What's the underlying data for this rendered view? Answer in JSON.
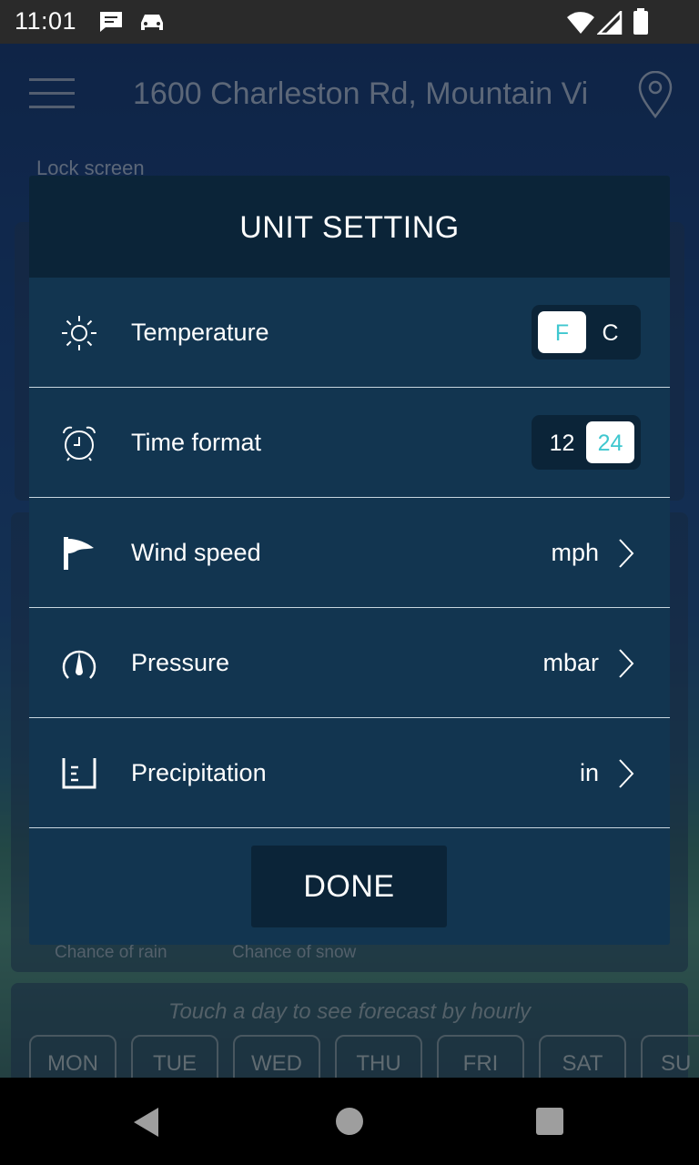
{
  "status_bar": {
    "time": "11:01",
    "left_icons": [
      "message-icon",
      "car-icon"
    ],
    "right_icons": [
      "wifi-icon",
      "signal-icon",
      "battery-icon"
    ]
  },
  "background": {
    "address": "1600 Charleston Rd, Mountain Vi",
    "lock_screen_label": "Lock screen",
    "chance_of_rain": "Chance of rain",
    "chance_of_snow": "Chance of snow",
    "hint": "Touch a day to see forecast by hourly",
    "days": [
      "MON",
      "TUE",
      "WED",
      "THU",
      "FRI",
      "SAT",
      "SU"
    ]
  },
  "dialog": {
    "title": "UNIT SETTING",
    "rows": [
      {
        "label": "Temperature",
        "icon": "sun-icon",
        "type": "toggle",
        "options": [
          "F",
          "C"
        ],
        "selected": "F"
      },
      {
        "label": "Time format",
        "icon": "alarm-clock-icon",
        "type": "toggle",
        "options": [
          "12",
          "24"
        ],
        "selected": "24"
      },
      {
        "label": "Wind speed",
        "icon": "wind-flag-icon",
        "type": "select",
        "value": "mph"
      },
      {
        "label": "Pressure",
        "icon": "gauge-icon",
        "type": "select",
        "value": "mbar"
      },
      {
        "label": "Precipitation",
        "icon": "rain-gauge-icon",
        "type": "select",
        "value": "in"
      }
    ],
    "done_label": "DONE"
  },
  "colors": {
    "dialog_bg": "#123550",
    "dialog_header_bg": "#0b2438",
    "toggle_active_text": "#3fc7cf",
    "divider": "#c8d6df"
  },
  "nav_bar": {
    "icons": [
      "back-icon",
      "home-icon",
      "recents-icon"
    ]
  }
}
